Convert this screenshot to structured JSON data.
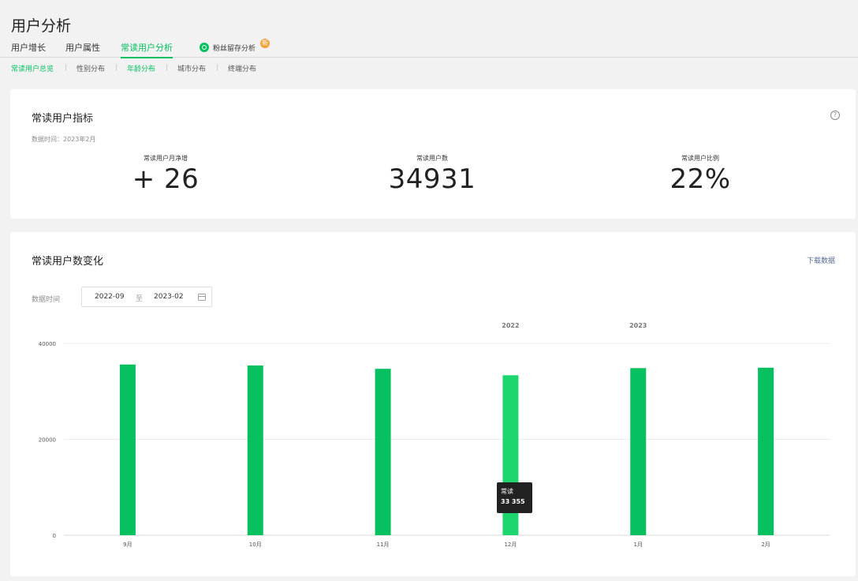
{
  "page": {
    "title": "用户分析"
  },
  "main_tabs": [
    {
      "label": "用户增长"
    },
    {
      "label": "用户属性"
    },
    {
      "label": "常读用户分析"
    },
    {
      "label": "粉丝留存分析",
      "badge": "新"
    }
  ],
  "sub_tabs": [
    {
      "label": "常读用户总览"
    },
    {
      "label": "性别分布"
    },
    {
      "label": "年龄分布"
    },
    {
      "label": "城市分布"
    },
    {
      "label": "终端分布"
    }
  ],
  "metrics_card": {
    "title": "常读用户指标",
    "help": "?",
    "data_time": "数据时间：2023年2月",
    "metrics": [
      {
        "label": "常读用户月净增",
        "value": "+ 26"
      },
      {
        "label": "常读用户数",
        "value": "34931"
      },
      {
        "label": "常读用户比例",
        "value": "22%"
      }
    ]
  },
  "trend_card": {
    "title": "常读用户数变化",
    "download": "下载数据",
    "range_label": "数据时间",
    "range_start": "2022-09",
    "range_to": "至",
    "range_end": "2023-02",
    "tooltip": {
      "series": "常读",
      "value": "33 355"
    }
  },
  "colors": {
    "accent": "#07c160",
    "bar": "#07c160",
    "bar_hover": "#1ed66e",
    "link": "#576b95"
  },
  "chart_data": {
    "type": "bar",
    "categories": [
      "9月",
      "10月",
      "11月",
      "12月",
      "1月",
      "2月"
    ],
    "year_labels": [
      {
        "text": "2022",
        "at": "12月"
      },
      {
        "text": "2023",
        "at": "1月"
      }
    ],
    "series": [
      {
        "values": [
          35600,
          35400,
          34700,
          33355,
          34850,
          34931
        ]
      }
    ],
    "highlighted_index": 3,
    "yticks": [
      0,
      20000,
      40000
    ],
    "ylim": [
      0,
      40000
    ],
    "grid": true
  }
}
